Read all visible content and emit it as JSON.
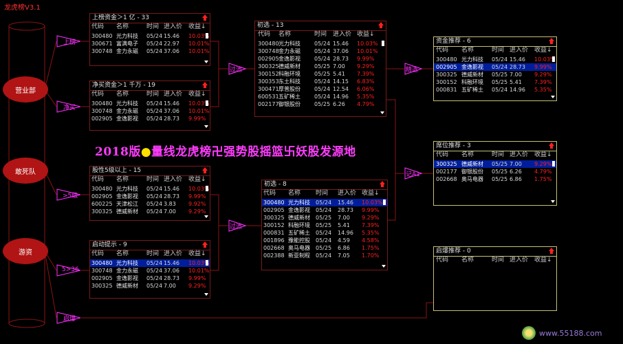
{
  "app_title": "龙虎榜V3.1",
  "left_nodes": [
    "营业部",
    "敢死队",
    "游资"
  ],
  "flags": {
    "shangbang": "上榜",
    "jingmai": "净买",
    "wuji": ">5级",
    "wusanliu": "5>36",
    "qibao": "启爆",
    "guolv1": "过滤",
    "guolv2": "过滤",
    "jingxuan": "精选",
    "jiyi": "记A1"
  },
  "banner": {
    "year": "2018版",
    "dot": "●",
    "text": "量线龙虎榜卍强势股摇篮卐妖股发源地"
  },
  "columns": {
    "code": "代码",
    "name": "名称",
    "date": "时间",
    "price": "进入价",
    "gain": "收益↓"
  },
  "panels": {
    "p_shangbang": {
      "title": "上榜资金＞1 亿 - 33",
      "rows": [
        [
          "300480",
          "光力科技",
          "05/24",
          "15.46",
          "10.03%"
        ],
        [
          "300671",
          "富满电子",
          "05/24",
          "22.97",
          "10.01%"
        ],
        [
          "300748",
          "金力永磁",
          "05/24",
          "37.06",
          "10.01%"
        ]
      ]
    },
    "p_jingmai": {
      "title": "净买资金＞1 千万 - 19",
      "rows": [
        [
          "300480",
          "光力科技",
          "05/24",
          "15.46",
          "10.03%"
        ],
        [
          "300748",
          "金力永磁",
          "05/24",
          "37.06",
          "10.01%"
        ],
        [
          "002905",
          "金逸影视",
          "05/24",
          "28.73",
          "9.99%"
        ]
      ]
    },
    "p_wuji": {
      "title": "股性5级以上 - 15",
      "rows": [
        [
          "300480",
          "光力科技",
          "05/24",
          "15.46",
          "10.03%"
        ],
        [
          "002905",
          "金逸影视",
          "05/24",
          "28.73",
          "9.99%"
        ],
        [
          "600225",
          "天津松江",
          "05/24",
          "3.83",
          "9.92%"
        ],
        [
          "300325",
          "德威新材",
          "05/24",
          "7.00",
          "9.29%"
        ]
      ]
    },
    "p_qidong": {
      "title": "启动提示 - 9",
      "rows": [
        [
          "300480",
          "光力科技",
          "05/24",
          "15.46",
          "10.03%"
        ],
        [
          "300748",
          "金力永磁",
          "05/24",
          "37.06",
          "10.01%"
        ],
        [
          "002905",
          "金逸影视",
          "05/24",
          "28.73",
          "9.99%"
        ],
        [
          "300325",
          "德威新材",
          "05/24",
          "7.00",
          "9.29%"
        ]
      ]
    },
    "p_chuxuan13": {
      "title": "初选 - 13",
      "rows": [
        [
          "300480",
          "光力科技",
          "05/24",
          "15.46",
          "10.03%"
        ],
        [
          "300748",
          "金力永磁",
          "05/24",
          "37.06",
          "10.01%"
        ],
        [
          "002905",
          "金逸影视",
          "05/24",
          "28.73",
          "9.99%"
        ],
        [
          "300325",
          "德威新材",
          "05/25",
          "7.00",
          "9.29%"
        ],
        [
          "300152",
          "科融环境",
          "05/25",
          "5.41",
          "7.39%"
        ],
        [
          "300353",
          "东土科技",
          "05/24",
          "14.15",
          "6.83%"
        ],
        [
          "300471",
          "厚普股份",
          "05/24",
          "12.54",
          "6.06%"
        ],
        [
          "600531",
          "五矿稀土",
          "05/24",
          "14.96",
          "5.35%"
        ],
        [
          "002177",
          "御银股份",
          "05/25",
          "6.26",
          "4.79%"
        ]
      ]
    },
    "p_chuxuan8": {
      "title": "初选 - 8",
      "rows": [
        [
          "300480",
          "光力科技",
          "05/24",
          "15.46",
          "10.03%"
        ],
        [
          "002905",
          "金逸影视",
          "05/24",
          "28.73",
          "9.99%"
        ],
        [
          "300325",
          "德威新材",
          "05/25",
          "7.00",
          "9.29%"
        ],
        [
          "300152",
          "科融环境",
          "05/25",
          "5.41",
          "7.39%"
        ],
        [
          "000831",
          "五矿稀土",
          "05/24",
          "14.96",
          "5.35%"
        ],
        [
          "001896",
          "豫能控股",
          "05/24",
          "4.59",
          "4.58%"
        ],
        [
          "002668",
          "奥马电器",
          "05/25",
          "6.86",
          "1.75%"
        ],
        [
          "002388",
          "新亚制程",
          "05/24",
          "7.05",
          "1.70%"
        ]
      ]
    },
    "p_zijin": {
      "title": "资金推荐 - 6",
      "rows": [
        [
          "300480",
          "光力科技",
          "05/24",
          "15.46",
          "10.03%"
        ],
        [
          "002905",
          "金逸影视",
          "05/24",
          "28.73",
          "9.99%"
        ],
        [
          "300325",
          "德威新材",
          "05/25",
          "7.00",
          "9.29%"
        ],
        [
          "300152",
          "科融环境",
          "05/25",
          "5.41",
          "7.39%"
        ],
        [
          "000831",
          "五矿稀土",
          "05/24",
          "14.96",
          "5.35%"
        ]
      ]
    },
    "p_xiwei": {
      "title": "席位推荐 - 3",
      "rows": [
        [
          "300325",
          "德威新材",
          "05/25",
          "7.00",
          "9.29%"
        ],
        [
          "002177",
          "御银股份",
          "05/25",
          "6.26",
          "4.79%"
        ],
        [
          "002668",
          "奥马电器",
          "05/25",
          "6.86",
          "1.75%"
        ]
      ]
    },
    "p_qibao": {
      "title": "启爆推荐 - 0",
      "rows": []
    }
  },
  "watermark": "www.55188.com",
  "colors": {
    "panel_border": "#7a1a1a",
    "yellow_border": "#c8c078",
    "gain": "#ff2020",
    "selected": "#001e9c",
    "flag": "#ff30ff",
    "banner": "#ff3cff"
  }
}
